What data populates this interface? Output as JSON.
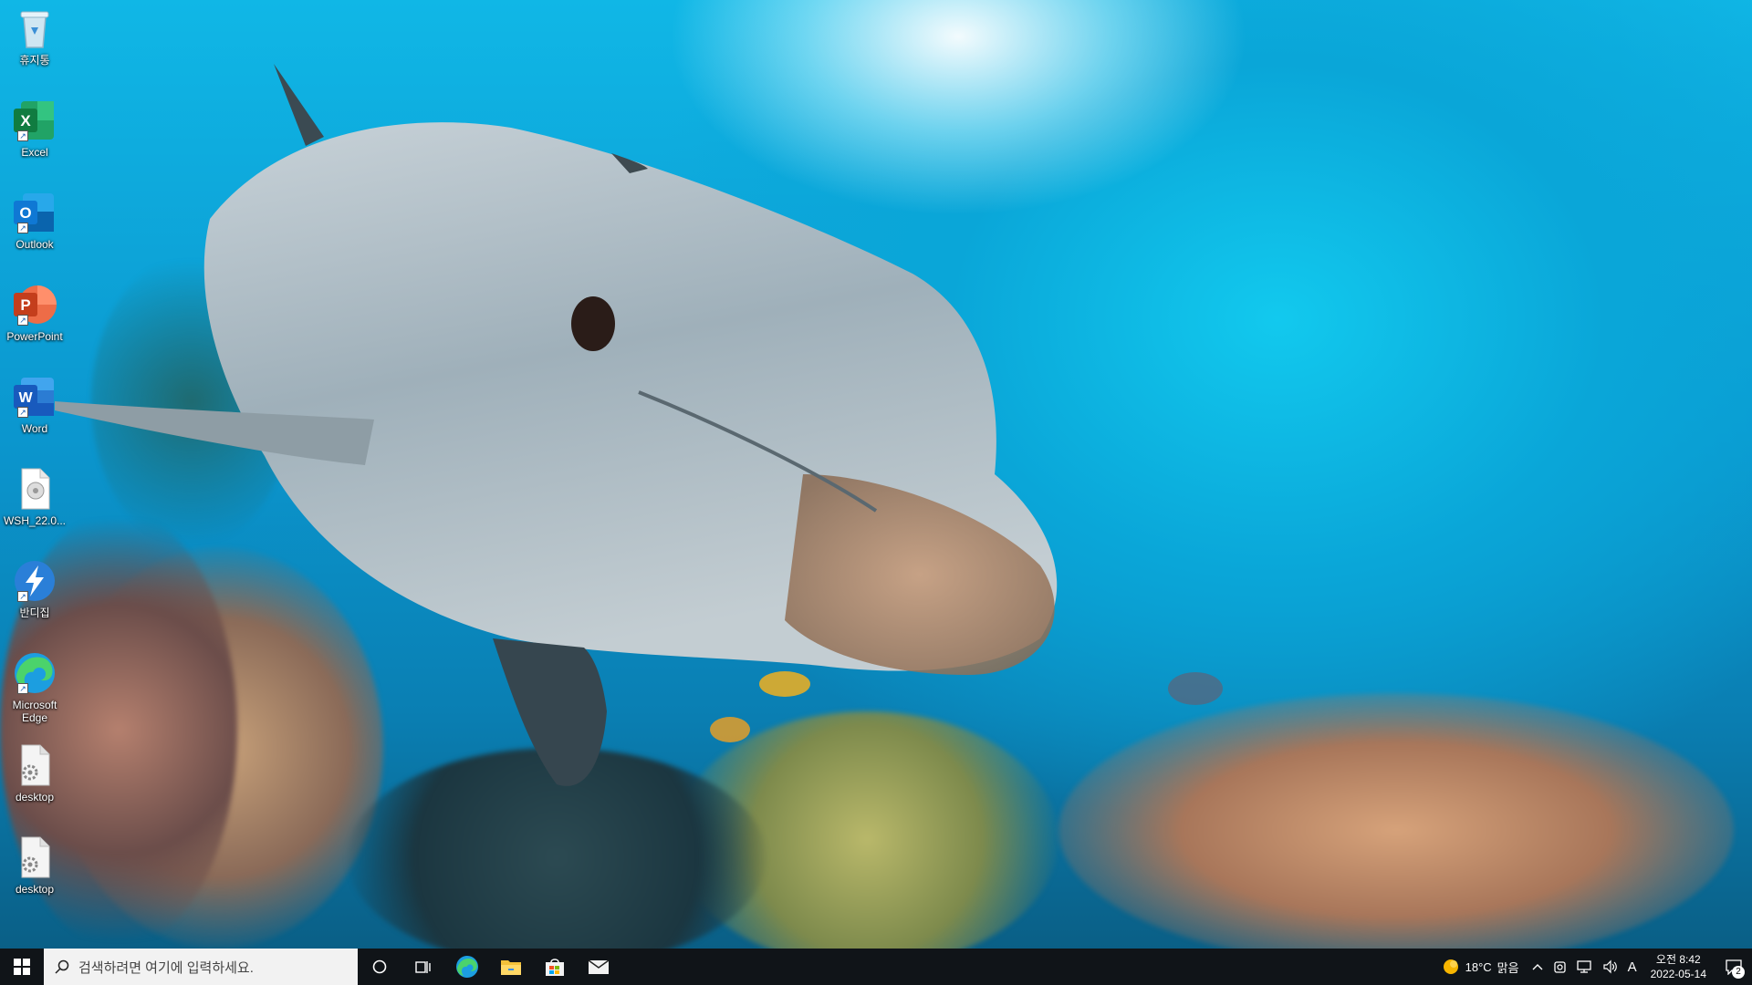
{
  "desktop": {
    "icons": [
      {
        "label": "휴지통",
        "icon": "recycle-bin-icon"
      },
      {
        "label": "Excel",
        "icon": "excel-icon",
        "letter": "X",
        "color": "#1d7a45"
      },
      {
        "label": "Outlook",
        "icon": "outlook-icon",
        "letter": "O",
        "color": "#1268c4"
      },
      {
        "label": "PowerPoint",
        "icon": "powerpoint-icon",
        "letter": "P",
        "color": "#d24726"
      },
      {
        "label": "Word",
        "icon": "word-icon",
        "letter": "W",
        "color": "#2b5fb5"
      },
      {
        "label": "WSH_22.0...",
        "icon": "file-icon"
      },
      {
        "label": "반디집",
        "icon": "bandizip-icon"
      },
      {
        "label": "Microsoft Edge",
        "icon": "edge-icon"
      },
      {
        "label": "desktop",
        "icon": "settings-file-icon"
      },
      {
        "label": "desktop",
        "icon": "settings-file-icon"
      }
    ]
  },
  "taskbar": {
    "search_placeholder": "검색하려면 여기에 입력하세요.",
    "pinned": [
      "cortana-icon",
      "task-view-icon",
      "edge-icon",
      "file-explorer-icon",
      "store-icon",
      "mail-icon"
    ],
    "weather": {
      "temp": "18°C",
      "condition": "맑음"
    },
    "ime": "A",
    "clock": {
      "time": "오전 8:42",
      "date": "2022-05-14"
    },
    "notifications": "2"
  }
}
